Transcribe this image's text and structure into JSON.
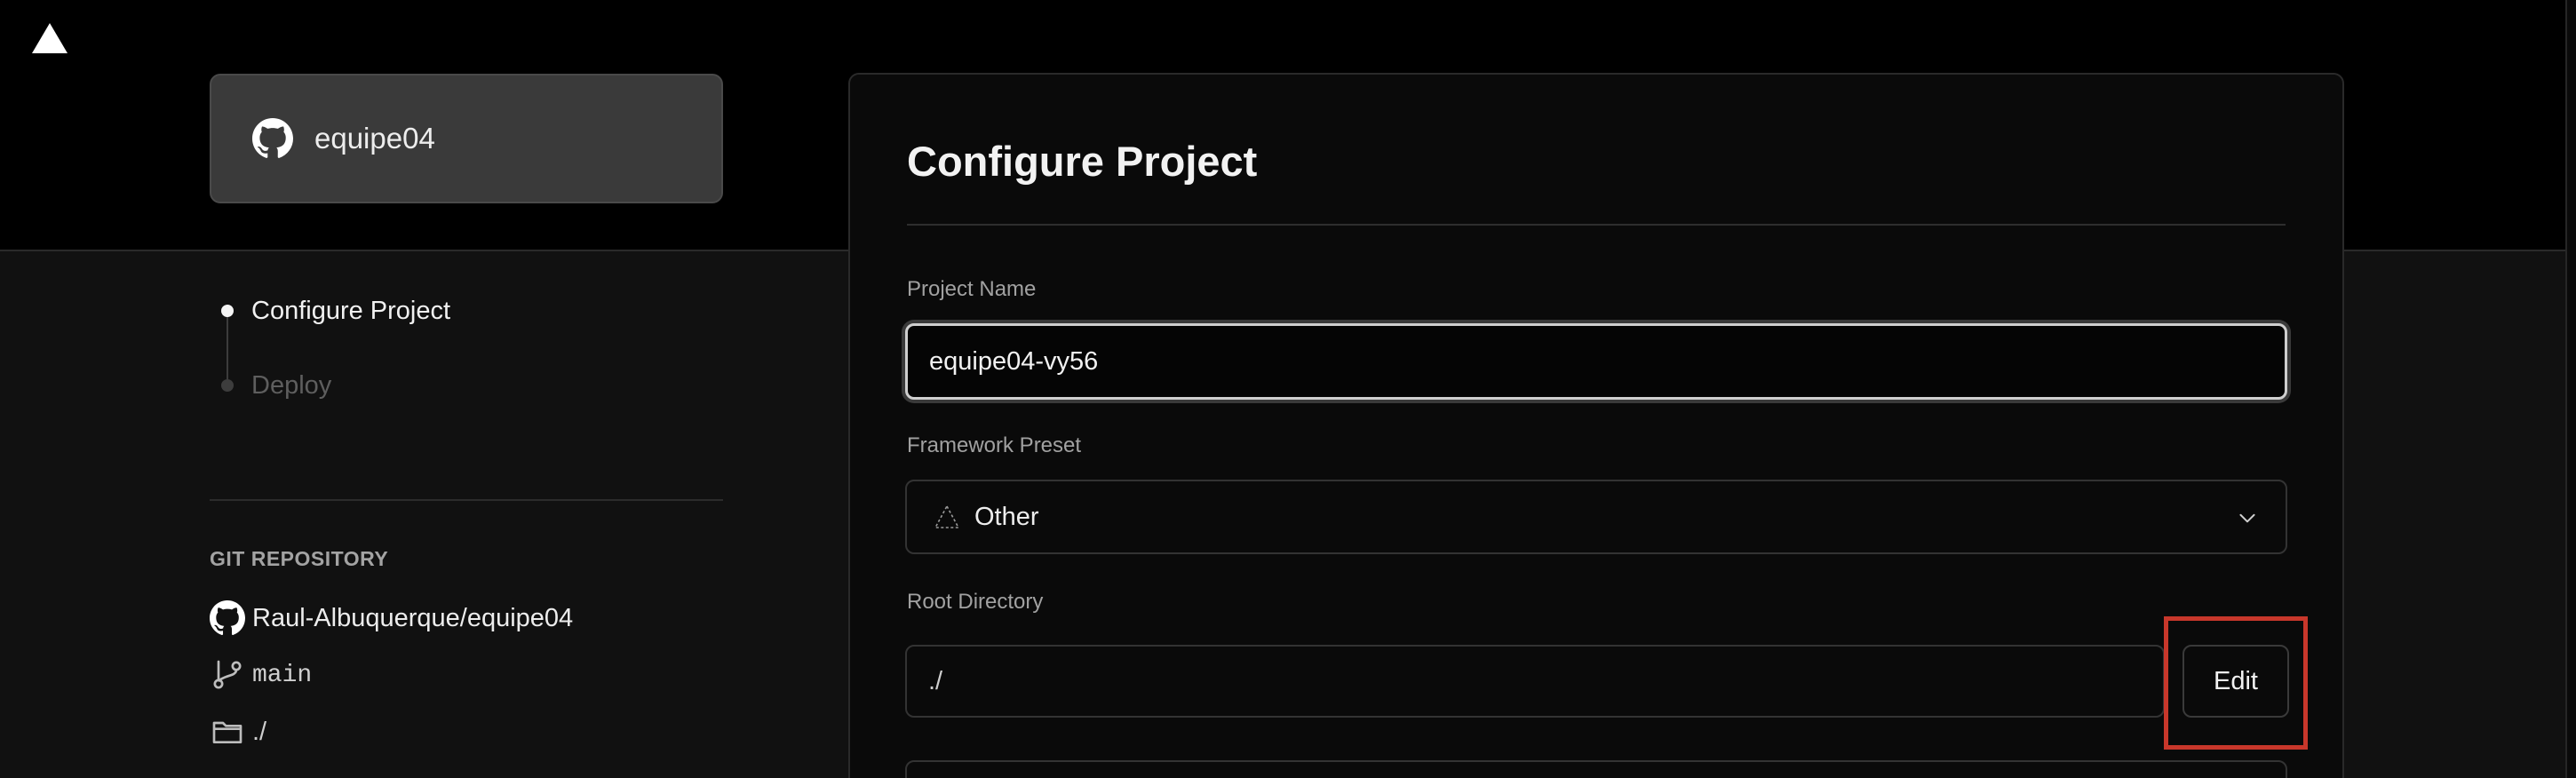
{
  "app": {
    "logo_icon": "vercel-triangle-icon"
  },
  "import_card": {
    "account_name": "equipe04",
    "icon": "github-icon"
  },
  "steps": [
    {
      "label": "Configure Project",
      "state": "active"
    },
    {
      "label": "Deploy",
      "state": "pending"
    }
  ],
  "git": {
    "heading": "GIT REPOSITORY",
    "repository": "Raul-Albuquerque/equipe04",
    "branch": "main",
    "directory": "./"
  },
  "configure": {
    "title": "Configure Project",
    "project_name_label": "Project Name",
    "project_name_value": "equipe04-vy56",
    "framework_label": "Framework Preset",
    "framework_value": "Other",
    "root_directory_label": "Root Directory",
    "root_directory_value": "./",
    "edit_label": "Edit"
  },
  "colors": {
    "background": "#000000",
    "panel": "#111111",
    "card": "#0a0a0a",
    "highlight": "#c8372b"
  }
}
